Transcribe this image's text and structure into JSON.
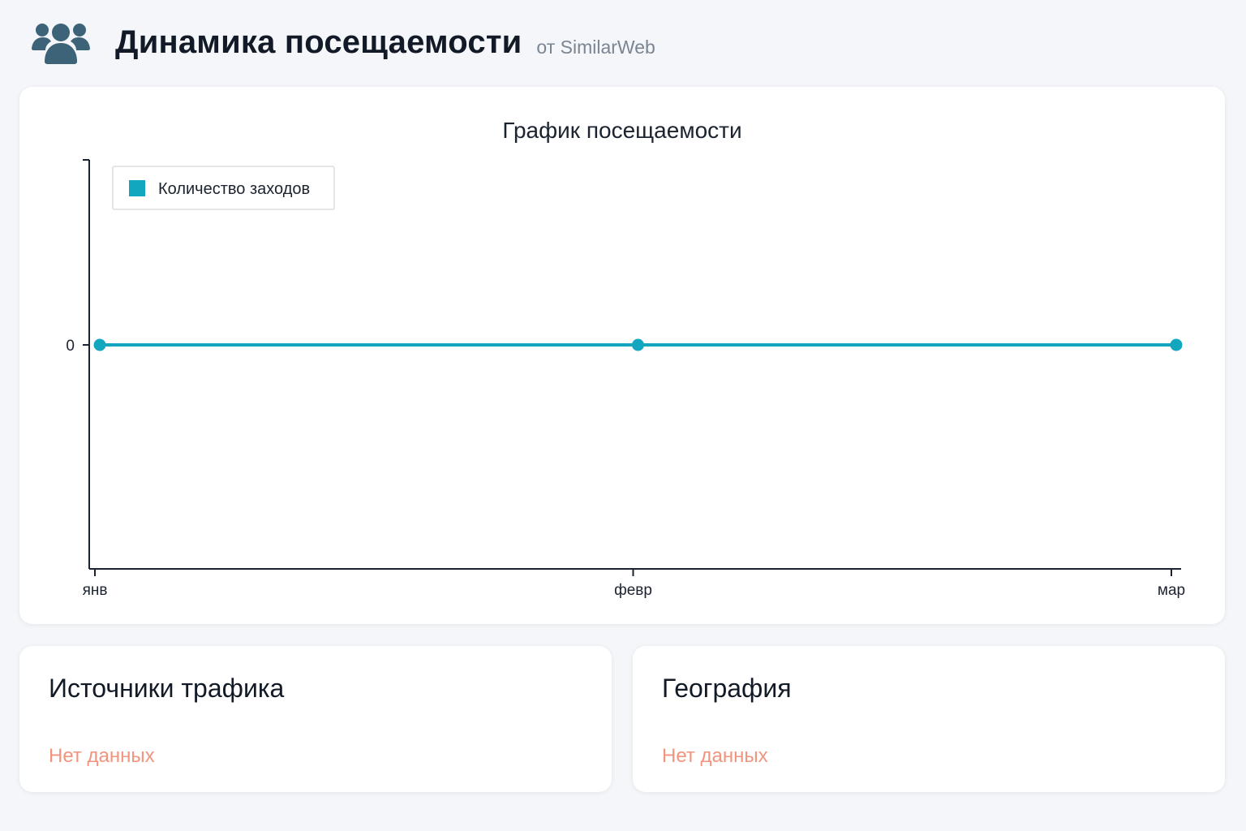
{
  "header": {
    "icon": "users-group-icon",
    "title": "Динамика посещаемости",
    "subtitle": "от SimilarWeb"
  },
  "colors": {
    "series": "#12a6bf",
    "no_data": "#f2947e",
    "icon": "#3d6378"
  },
  "chart_data": {
    "type": "line",
    "title": "График посещаемости",
    "x": [
      "янв",
      "февр",
      "мар"
    ],
    "series": [
      {
        "name": "Количество заходов",
        "values": [
          0,
          0,
          0
        ]
      }
    ],
    "yticks": [
      "0"
    ],
    "ylim": [
      -1,
      1
    ],
    "legend": "top-left",
    "grid": false
  },
  "sources": {
    "title": "Источники трафика",
    "empty_text": "Нет данных"
  },
  "geography": {
    "title": "География",
    "empty_text": "Нет данных"
  }
}
